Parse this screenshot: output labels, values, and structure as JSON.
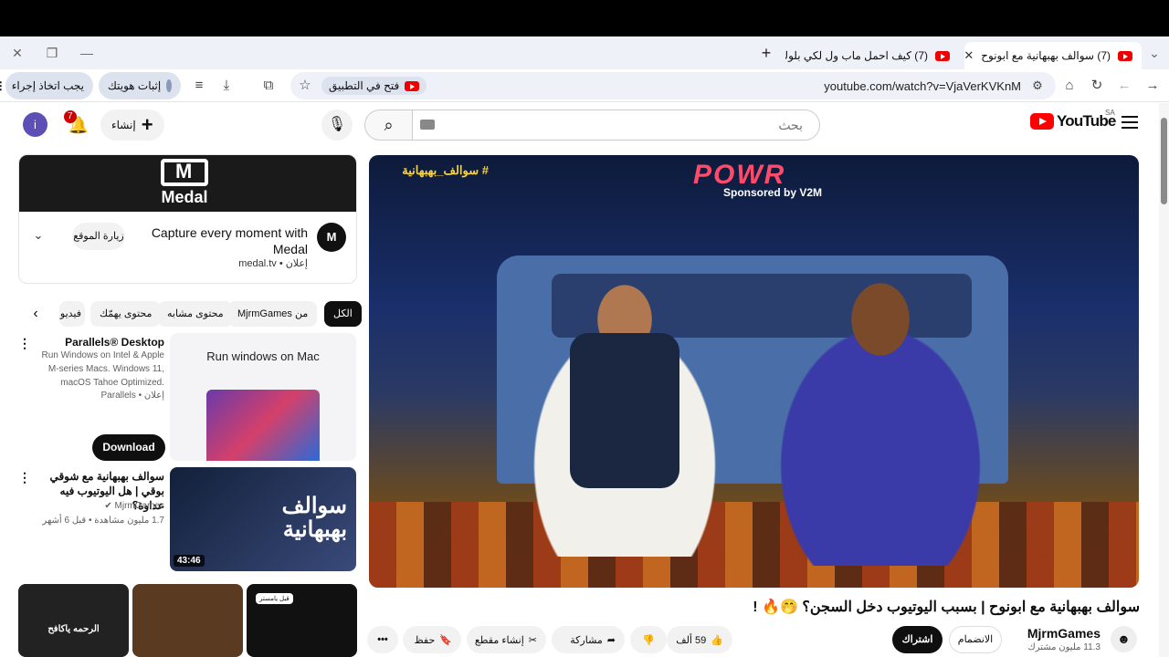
{
  "browser": {
    "tabs": [
      {
        "title": "(7) سوالف بهبهانية مع ابونوح",
        "active": true
      },
      {
        "title": "(7) كيف احمل ماب ول لكي بلوك",
        "active": false
      }
    ],
    "url": "youtube.com/watch?v=VjaVerKVKnM",
    "open_in_app": "فتح في التطبيق",
    "verify_identity": "إثبات هويتك",
    "action_needed": "يجب اتخاذ إجراء"
  },
  "header": {
    "logo": "YouTube",
    "region": "SA",
    "search_placeholder": "بحث",
    "create_label": "إنشاء",
    "notifications_count": "7",
    "avatar_letter": "i"
  },
  "ad": {
    "banner_text": "Medal",
    "title": "Capture every moment with Medal",
    "meta": "إعلان • medal.tv",
    "visit_label": "زيارة الموقع"
  },
  "chips": [
    "الكل",
    "من MjrmGames",
    "محتوى مشابه",
    "محتوى يهمّك",
    "فيديو"
  ],
  "sidebar": {
    "parallels": {
      "title": "Parallels® Desktop",
      "desc": "Run Windows on Intel & Apple M-series Macs. Windows 11, macOS Tahoe Optimized.",
      "meta": "إعلان • Parallels",
      "cta": "Download",
      "thumb_text": "Run windows on Mac"
    },
    "video1": {
      "title": "سوالف بهبهانية مع شوقي بوقي | هل اليوتيوب فيه عداوة؟",
      "channel": "MjrmGames",
      "meta": "1.7 مليون مشاهدة • قبل 6 أشهر",
      "duration": "43:46",
      "thumb_text": "سوالف بهبهانية"
    },
    "shorts": [
      "الرحمه ياكافح",
      "",
      "قبل يامستر"
    ]
  },
  "video": {
    "title": "سوالف بهبهانية مع ابونوح | بسبب اليوتيوب دخل السجن؟ 🤭🔥 !",
    "overlay_hashtag": "# سوالف_بهبهانية",
    "sign": "POWR",
    "sponsor": "Sponsored by V2M",
    "channel": "MjrmGames",
    "subs": "11.3 مليون مشترك",
    "join": "الانضمام",
    "subscribe": "اشتراك",
    "likes": "59 ألف",
    "share": "مشاركة",
    "clip": "إنشاء مقطع",
    "save": "حفظ"
  }
}
